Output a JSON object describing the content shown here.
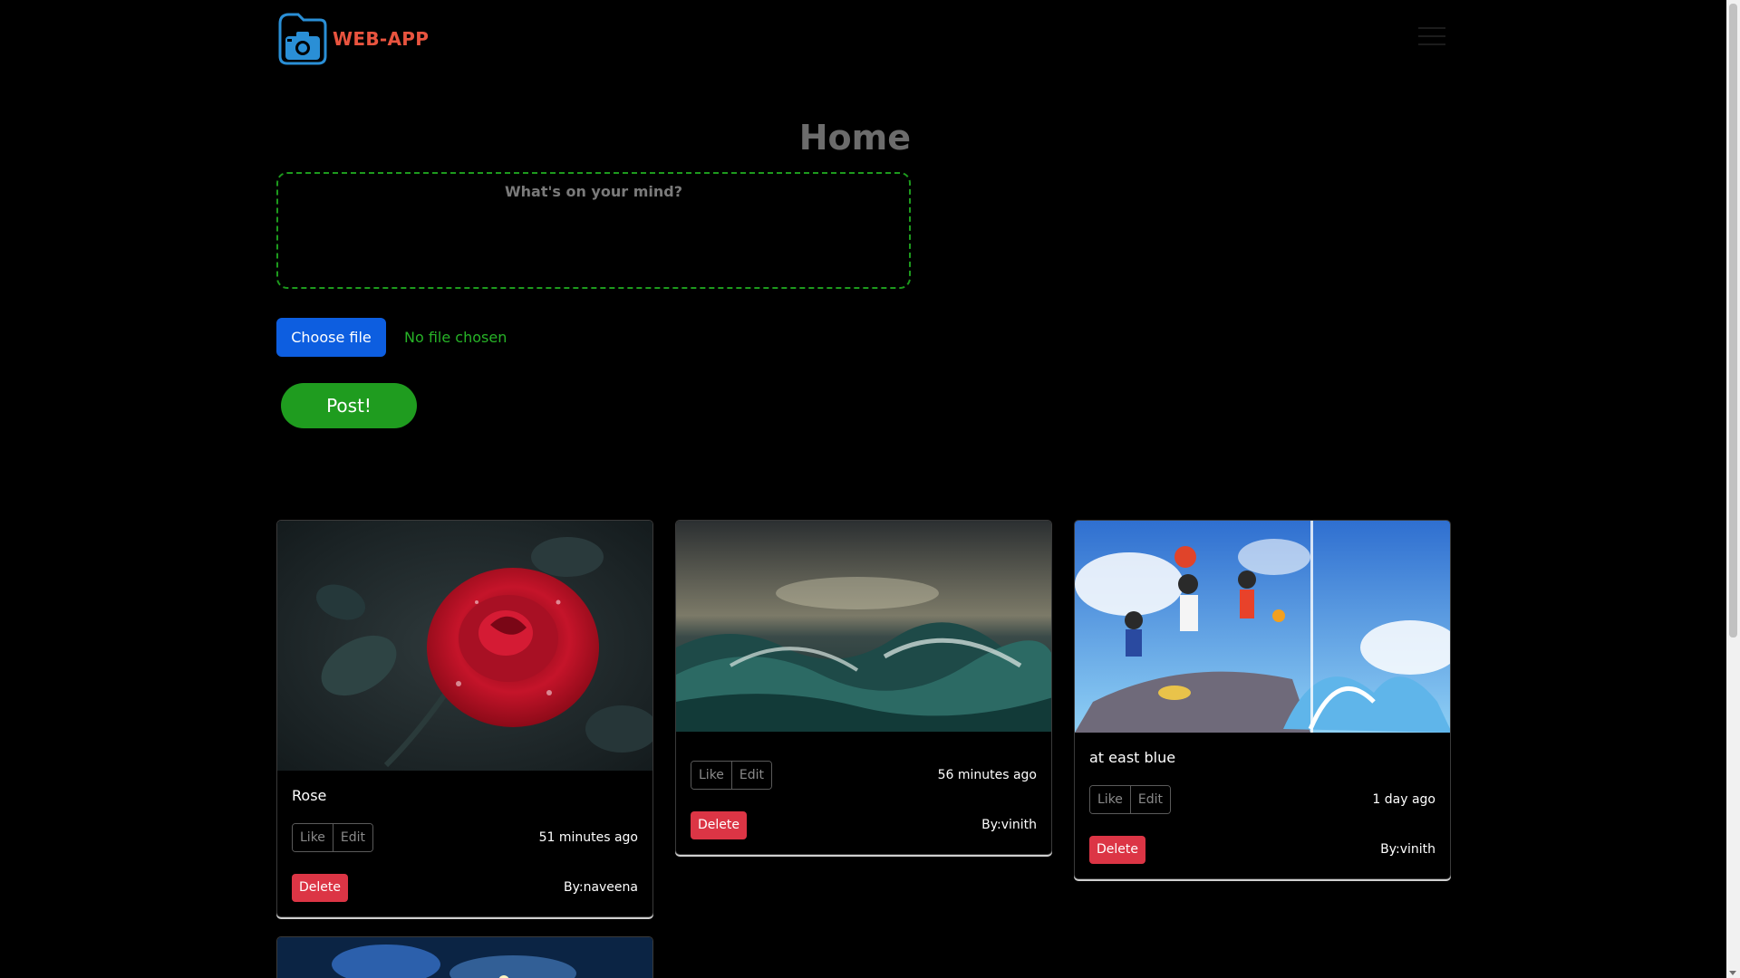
{
  "brand": {
    "name": "WEB-APP",
    "logo_icon": "camera-folder-icon",
    "color": "#e9543f"
  },
  "header": {
    "menu_icon": "hamburger-menu-icon"
  },
  "main": {
    "title": "Home",
    "post_input": {
      "placeholder": "What's on your mind?",
      "value": ""
    },
    "file_input": {
      "button_label": "Choose file",
      "status": "No file chosen"
    },
    "post_button_label": "Post!"
  },
  "posts": [
    {
      "caption": "Rose",
      "like_label": "Like",
      "edit_label": "Edit",
      "time": "51 minutes ago",
      "delete_label": "Delete",
      "author": "By:naveena",
      "image": "red-rose-photo"
    },
    {
      "caption": "",
      "like_label": "Like",
      "edit_label": "Edit",
      "time": "56 minutes ago",
      "delete_label": "Delete",
      "author": "By:vinith",
      "image": "ocean-waves-photo"
    },
    {
      "caption": "at east blue",
      "like_label": "Like",
      "edit_label": "Edit",
      "time": "1 day ago",
      "delete_label": "Delete",
      "author": "By:vinith",
      "image": "anime-ocean-illustration"
    },
    {
      "image": "night-sky-illustration"
    }
  ],
  "colors": {
    "background": "#000000",
    "accent_green": "#1f9c1f",
    "primary_blue": "#0d5ee0",
    "danger_red": "#dc3545"
  }
}
